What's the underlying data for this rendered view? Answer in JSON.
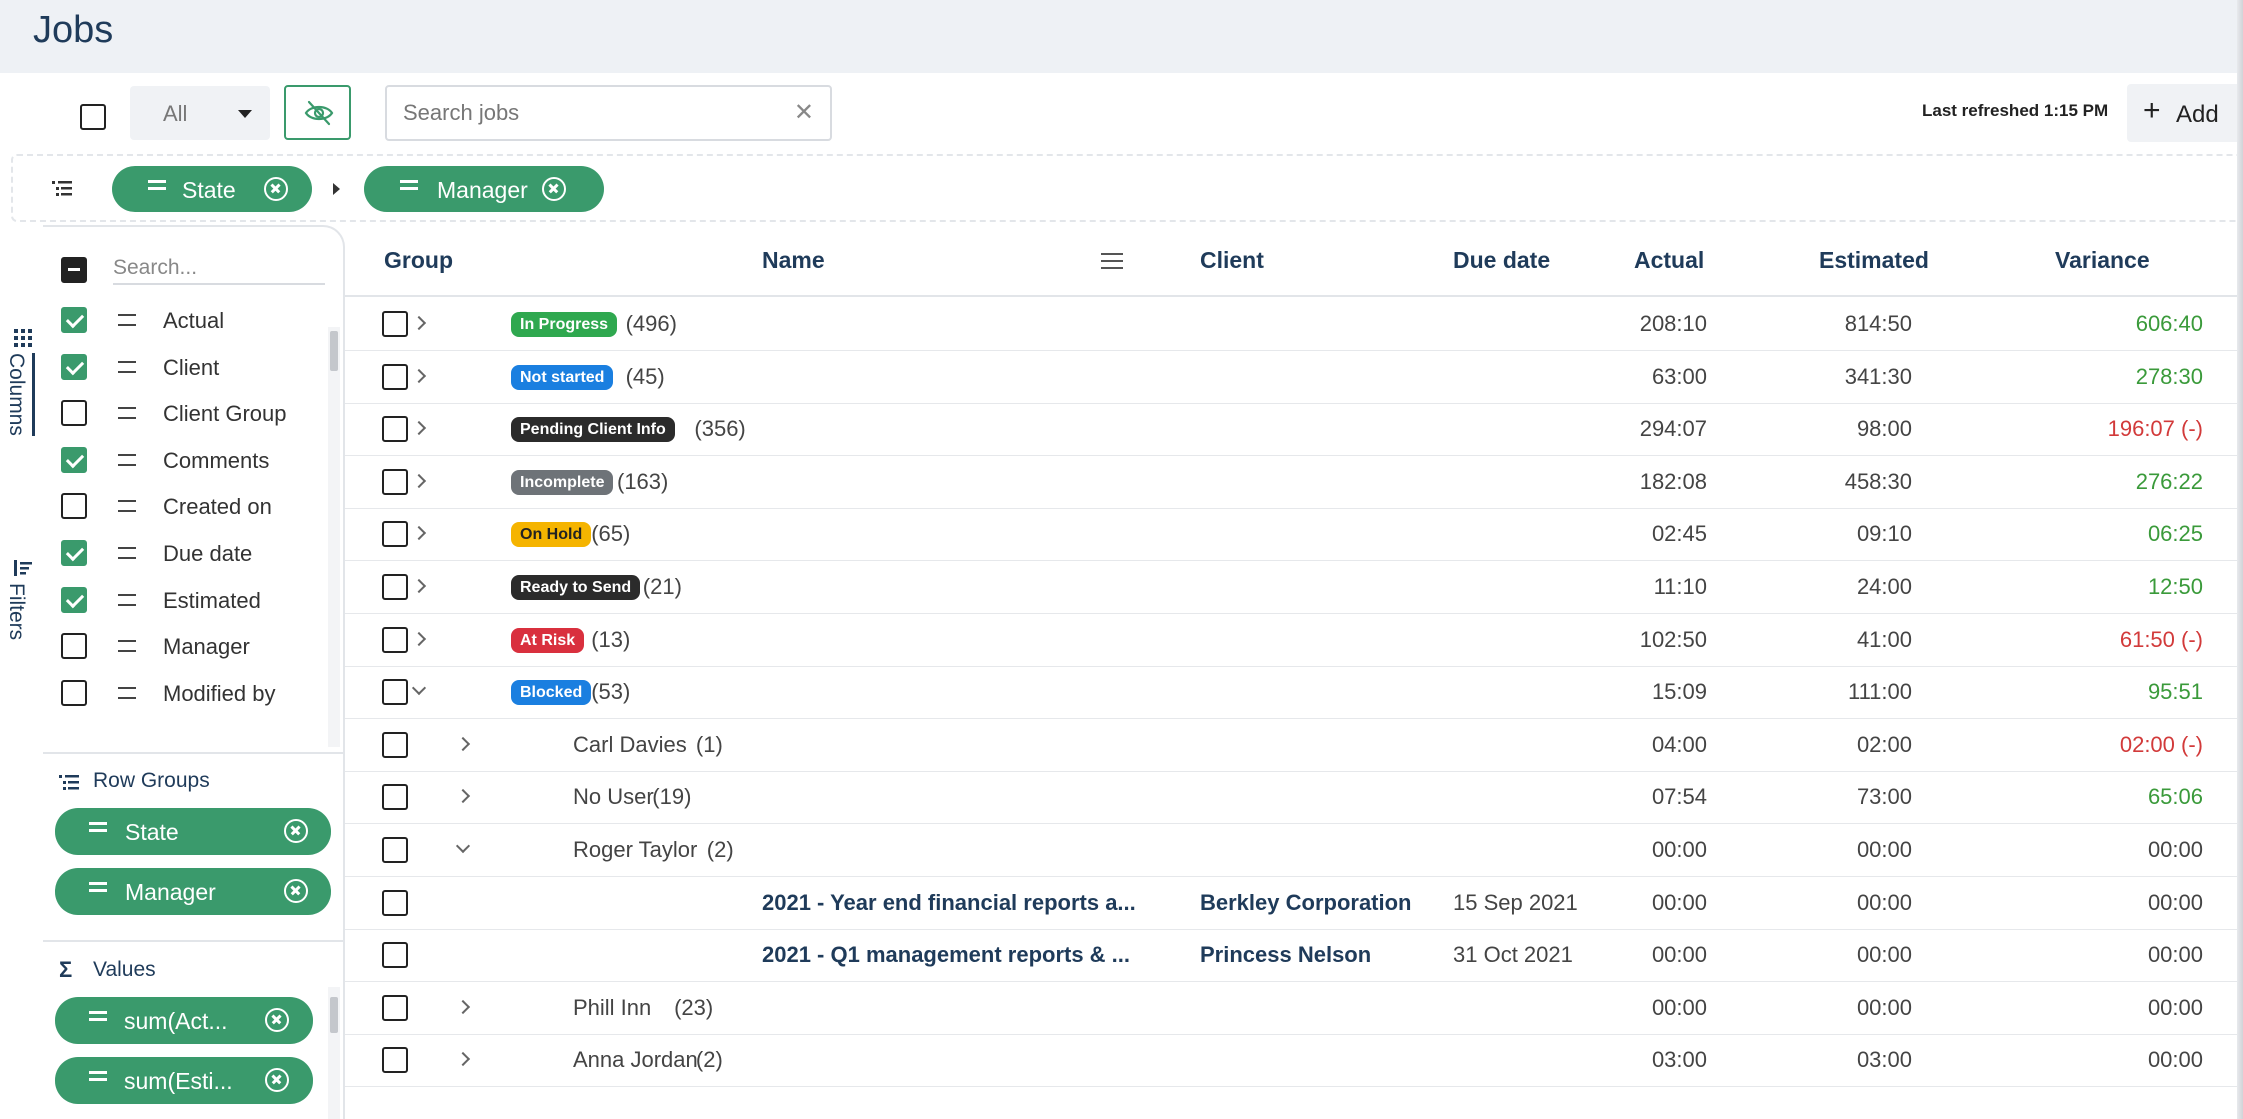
{
  "page": {
    "title": "Jobs"
  },
  "toolbar": {
    "filter_value": "All",
    "search_placeholder": "Search jobs",
    "search_clear": "✕",
    "last_refreshed": "Last refreshed 1:15 PM",
    "add_label": "Add",
    "add_icon": "+"
  },
  "group_bar": {
    "chips": [
      {
        "label": "State"
      },
      {
        "label": "Manager"
      }
    ]
  },
  "side_tabs": {
    "columns": "Columns",
    "filters": "Filters"
  },
  "tool_panel": {
    "search_placeholder": "Search...",
    "columns": [
      {
        "label": "Actual",
        "checked": true
      },
      {
        "label": "Client",
        "checked": true
      },
      {
        "label": "Client Group",
        "checked": false
      },
      {
        "label": "Comments",
        "checked": true
      },
      {
        "label": "Created on",
        "checked": false
      },
      {
        "label": "Due date",
        "checked": true
      },
      {
        "label": "Estimated",
        "checked": true
      },
      {
        "label": "Manager",
        "checked": false
      },
      {
        "label": "Modified by",
        "checked": false
      }
    ],
    "row_groups_title": "Row Groups",
    "row_groups": [
      {
        "label": "State"
      },
      {
        "label": "Manager"
      }
    ],
    "values_title": "Values",
    "values_icon": "Σ",
    "values": [
      {
        "label": "sum(Act..."
      },
      {
        "label": "sum(Esti..."
      }
    ]
  },
  "grid": {
    "headers": {
      "group": "Group",
      "name": "Name",
      "client": "Client",
      "due_date": "Due date",
      "actual": "Actual",
      "estimated": "Estimated",
      "variance": "Variance"
    },
    "rows": [
      {
        "type": "group",
        "badge": "In Progress",
        "badge_color": "#2fa84f",
        "count": "(496)",
        "actual": "208:10",
        "estimated": "814:50",
        "variance": "606:40",
        "variance_status": "pos"
      },
      {
        "type": "group",
        "badge": "Not started",
        "badge_color": "#1a7fe0",
        "count": "(45)",
        "actual": "63:00",
        "estimated": "341:30",
        "variance": "278:30",
        "variance_status": "pos"
      },
      {
        "type": "group",
        "badge": "Pending Client Info",
        "badge_color": "#2b2b2b",
        "count": "(356)",
        "actual": "294:07",
        "estimated": "98:00",
        "variance": "196:07 (-)",
        "variance_status": "neg"
      },
      {
        "type": "group",
        "badge": "Incomplete",
        "badge_color": "#6e7378",
        "count": "(163)",
        "actual": "182:08",
        "estimated": "458:30",
        "variance": "276:22",
        "variance_status": "pos"
      },
      {
        "type": "group",
        "badge": "On Hold",
        "badge_color": "#f5b400",
        "badge_text": "#222222",
        "count": "(65)",
        "actual": "02:45",
        "estimated": "09:10",
        "variance": "06:25",
        "variance_status": "pos"
      },
      {
        "type": "group",
        "badge": "Ready to Send",
        "badge_color": "#2b2b2b",
        "count": "(21)",
        "actual": "11:10",
        "estimated": "24:00",
        "variance": "12:50",
        "variance_status": "pos"
      },
      {
        "type": "group",
        "badge": "At Risk",
        "badge_color": "#d9303e",
        "count": "(13)",
        "actual": "102:50",
        "estimated": "41:00",
        "variance": "61:50 (-)",
        "variance_status": "neg"
      },
      {
        "type": "group",
        "badge": "Blocked",
        "badge_color": "#1a7fe0",
        "count": "(53)",
        "expanded": true,
        "actual": "15:09",
        "estimated": "111:00",
        "variance": "95:51",
        "variance_status": "pos"
      },
      {
        "type": "sub",
        "name": "Carl Davies",
        "count": "(1)",
        "actual": "04:00",
        "estimated": "02:00",
        "variance": "02:00 (-)",
        "variance_status": "neg"
      },
      {
        "type": "sub",
        "name": "No User",
        "count": "(19)",
        "actual": "07:54",
        "estimated": "73:00",
        "variance": "65:06",
        "variance_status": "pos"
      },
      {
        "type": "sub",
        "name": "Roger Taylor",
        "count": "(2)",
        "expanded": true,
        "actual": "00:00",
        "estimated": "00:00",
        "variance": "00:00",
        "variance_status": "neutral"
      },
      {
        "type": "leaf",
        "name": "2021 - Year end financial reports a...",
        "client": "Berkley Corporation",
        "due": "15 Sep 2021",
        "actual": "00:00",
        "estimated": "00:00",
        "variance": "00:00",
        "variance_status": "neutral"
      },
      {
        "type": "leaf",
        "name": "2021 - Q1 management reports & ...",
        "client": "Princess Nelson",
        "due": "31 Oct 2021",
        "actual": "00:00",
        "estimated": "00:00",
        "variance": "00:00",
        "variance_status": "neutral"
      },
      {
        "type": "sub",
        "name": "Phill Inn",
        "count": "(23)",
        "actual": "00:00",
        "estimated": "00:00",
        "variance": "00:00",
        "variance_status": "neutral"
      },
      {
        "type": "sub",
        "name": "Anna Jordan",
        "count": "(2)",
        "actual": "03:00",
        "estimated": "03:00",
        "variance": "00:00",
        "variance_status": "neutral"
      }
    ]
  },
  "colors": {
    "accent": "#3a9a6c",
    "title": "#1f3b5a",
    "positive": "#3a9a3a",
    "negative": "#d23a3a"
  },
  "icons": [
    "eye-off-icon",
    "close-icon",
    "plus-icon",
    "group-list-icon",
    "columns-grid-icon",
    "filter-icon",
    "sigma-icon",
    "menu-icon",
    "chevron-right-icon",
    "chevron-down-icon",
    "drag-handle-icon"
  ]
}
